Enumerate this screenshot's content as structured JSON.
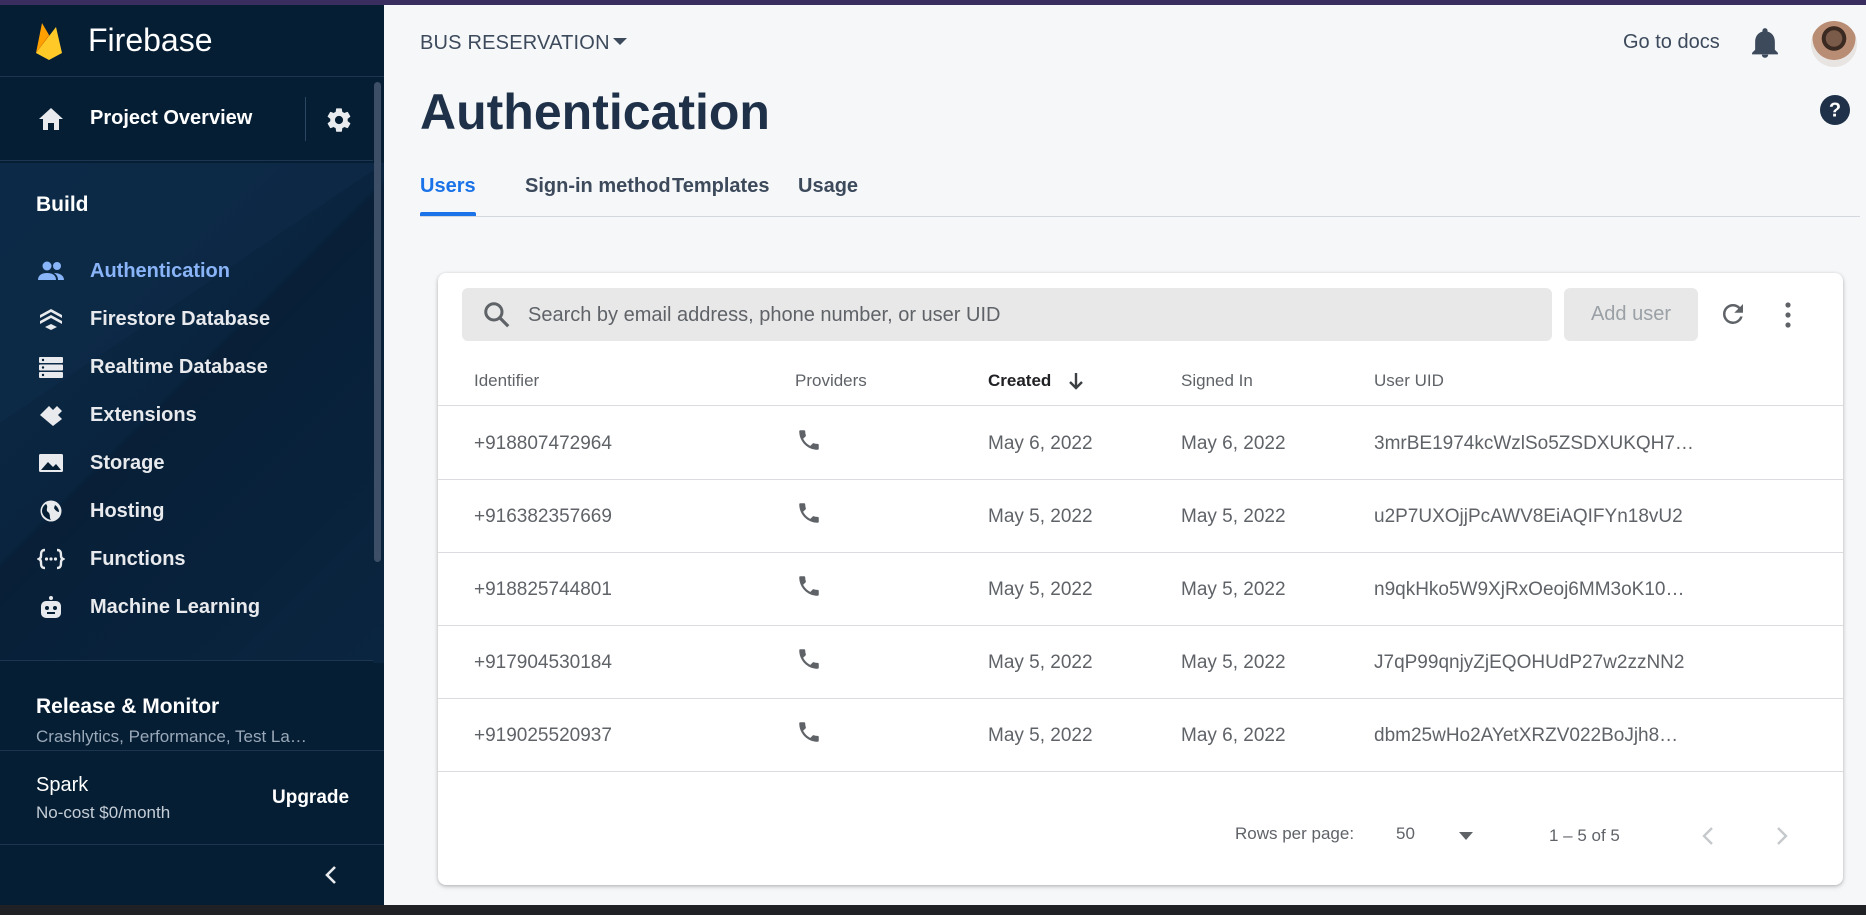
{
  "app": {
    "brand": "Firebase"
  },
  "sidebar": {
    "overview_label": "Project Overview",
    "build_title": "Build",
    "items": [
      {
        "label": "Authentication",
        "icon": "people-icon",
        "active": true
      },
      {
        "label": "Firestore Database",
        "icon": "firestore-icon",
        "active": false
      },
      {
        "label": "Realtime Database",
        "icon": "database-icon",
        "active": false
      },
      {
        "label": "Extensions",
        "icon": "extensions-icon",
        "active": false
      },
      {
        "label": "Storage",
        "icon": "image-icon",
        "active": false
      },
      {
        "label": "Hosting",
        "icon": "globe-icon",
        "active": false
      },
      {
        "label": "Functions",
        "icon": "functions-icon",
        "active": false
      },
      {
        "label": "Machine Learning",
        "icon": "robot-icon",
        "active": false
      }
    ],
    "release": {
      "title": "Release & Monitor",
      "subtitle": "Crashlytics, Performance, Test La…"
    },
    "plan": {
      "name": "Spark",
      "price": "No-cost $0/month",
      "upgrade_label": "Upgrade"
    }
  },
  "header": {
    "project_name": "BUS RESERVATION",
    "docs_label": "Go to docs",
    "page_title": "Authentication"
  },
  "tabs": [
    {
      "label": "Users",
      "active": true
    },
    {
      "label": "Sign-in method",
      "active": false
    },
    {
      "label": "Templates",
      "active": false
    },
    {
      "label": "Usage",
      "active": false
    }
  ],
  "users_table": {
    "search_placeholder": "Search by email address, phone number, or user UID",
    "add_user_label": "Add user",
    "columns": [
      "Identifier",
      "Providers",
      "Created",
      "Signed In",
      "User UID"
    ],
    "sorted_column": "Created",
    "rows": [
      {
        "identifier": "+918807472964",
        "provider": "phone-icon",
        "created": "May 6, 2022",
        "signed_in": "May 6, 2022",
        "uid": "3mrBE1974kcWzlSo5ZSDXUKQH7…"
      },
      {
        "identifier": "+916382357669",
        "provider": "phone-icon",
        "created": "May 5, 2022",
        "signed_in": "May 5, 2022",
        "uid": "u2P7UXOjjPcAWV8EiAQIFYn18vU2"
      },
      {
        "identifier": "+918825744801",
        "provider": "phone-icon",
        "created": "May 5, 2022",
        "signed_in": "May 5, 2022",
        "uid": "n9qkHko5W9XjRxOeoj6MM3oK10…"
      },
      {
        "identifier": "+917904530184",
        "provider": "phone-icon",
        "created": "May 5, 2022",
        "signed_in": "May 5, 2022",
        "uid": "J7qP99qnjyZjEQOHUdP27w2zzNN2"
      },
      {
        "identifier": "+919025520937",
        "provider": "phone-icon",
        "created": "May 5, 2022",
        "signed_in": "May 6, 2022",
        "uid": "dbm25wHo2AYetXRZV022BoJjh8…"
      }
    ],
    "rows_per_page_label": "Rows per page:",
    "rows_per_page_value": "50",
    "range_label": "1 – 5 of 5"
  },
  "colors": {
    "sidebar_bg": "#051e34",
    "accent": "#1a73e8",
    "active_nav": "#8ab4f8",
    "main_bg": "#f6f7f9"
  }
}
